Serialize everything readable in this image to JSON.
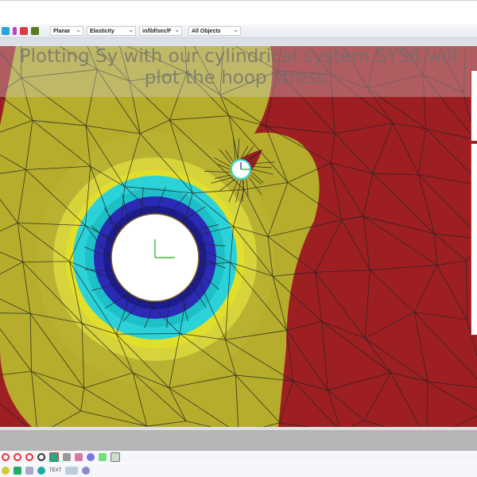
{
  "toolbar": {
    "analysis_type": "Planar",
    "material_model": "Elasticity",
    "units": "in/lbf/sec/F",
    "selection_filter": "All Objects"
  },
  "caption": {
    "line1": "Plotting Sy with our cylindrical system SYS6 will",
    "line2": "plot the hoop stress."
  },
  "bottom_toolbar": {
    "text_tool": "TEXT"
  },
  "colors": {
    "contour_max": "#9e1f22",
    "contour_high": "#b5ad2b",
    "contour_mid": "#e2df2c",
    "contour_low": "#2bd3d9",
    "contour_min": "#2a2ab5"
  }
}
